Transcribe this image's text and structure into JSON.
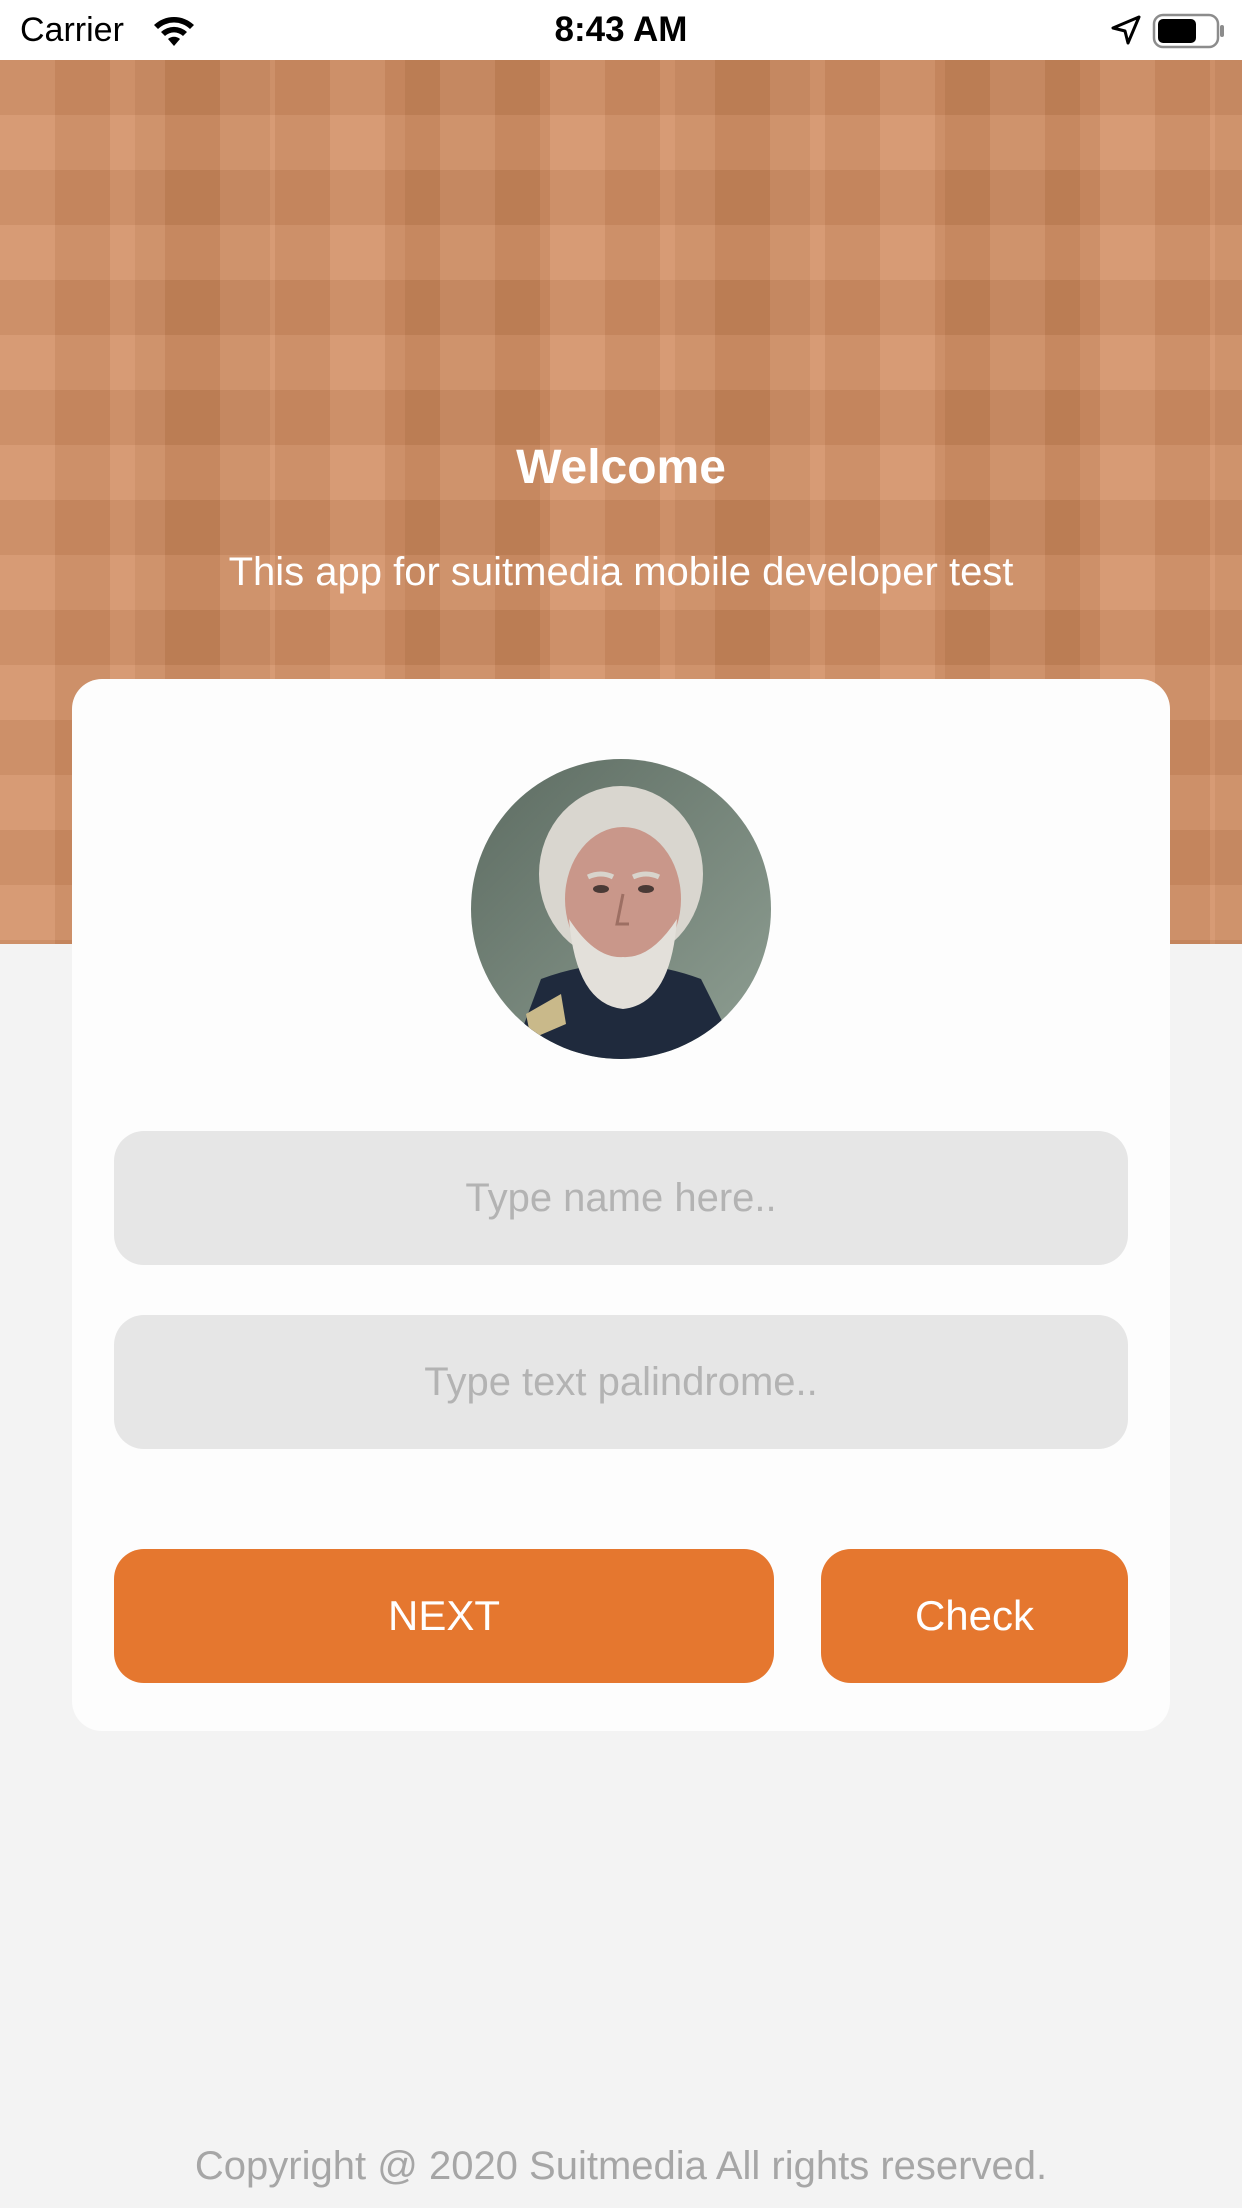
{
  "status_bar": {
    "carrier": "Carrier",
    "time": "8:43 AM",
    "icons": [
      "wifi-icon",
      "location-arrow-icon",
      "battery-icon"
    ]
  },
  "header": {
    "title": "Welcome",
    "subtitle": "This app for suitmedia mobile developer test",
    "background_color": "#d08a5e"
  },
  "form": {
    "avatar": "user-avatar-photo",
    "name_placeholder": "Type name here..",
    "name_value": "",
    "palindrome_placeholder": "Type text palindrome..",
    "palindrome_value": "",
    "next_label": "NEXT",
    "check_label": "Check",
    "button_color": "#e5772f"
  },
  "footer": {
    "copyright": "Copyright @ 2020 Suitmedia All rights reserved."
  }
}
